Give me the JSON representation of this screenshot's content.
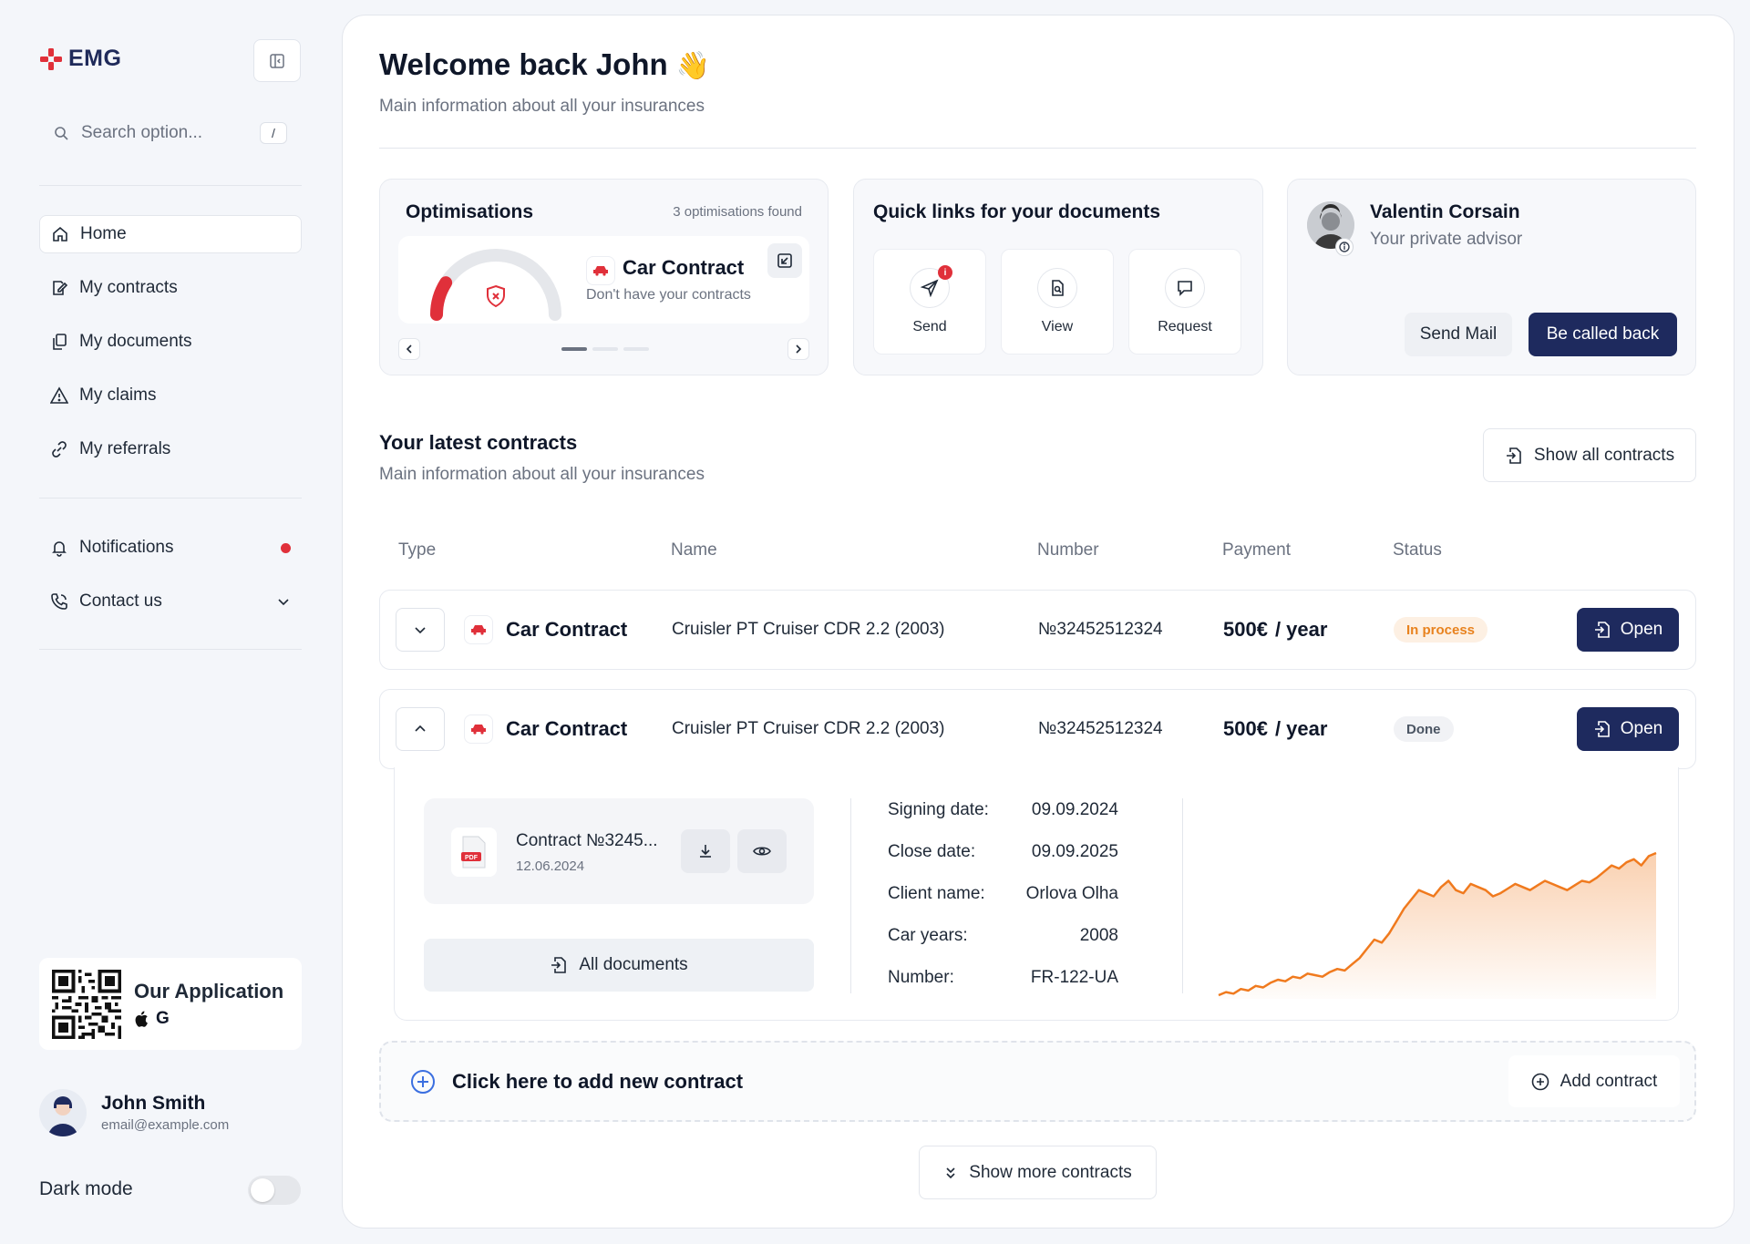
{
  "app": {
    "logo_text": "EMG",
    "brand_color": "#e0303a",
    "accent": "#1e2a5e"
  },
  "search": {
    "placeholder": "Search option...",
    "shortcut": "/"
  },
  "nav": {
    "items": [
      {
        "label": "Home",
        "icon": "home-icon"
      },
      {
        "label": "My contracts",
        "icon": "contract-icon"
      },
      {
        "label": "My documents",
        "icon": "documents-icon"
      },
      {
        "label": "My claims",
        "icon": "warning-icon"
      },
      {
        "label": "My referrals",
        "icon": "link-icon"
      }
    ],
    "notifications": "Notifications",
    "contact": "Contact us"
  },
  "app_promo": {
    "title": "Our Application",
    "stores": "G"
  },
  "user": {
    "name": "John Smith",
    "email": "email@example.com"
  },
  "dark_mode": {
    "label": "Dark mode"
  },
  "header": {
    "title": "Welcome back John",
    "emoji": "👋",
    "subtitle": "Main information about all your insurances"
  },
  "optimisations": {
    "title": "Optimisations",
    "count": "3 optimisations found",
    "gauge_fraction": 0.18,
    "item_title": "Car Contract",
    "item_sub": "Don't have your contracts"
  },
  "quick_links": {
    "title": "Quick links for your documents",
    "items": [
      {
        "label": "Send",
        "badge": "i"
      },
      {
        "label": "View"
      },
      {
        "label": "Request"
      }
    ]
  },
  "advisor": {
    "name": "Valentin Corsain",
    "role": "Your private advisor",
    "send_mail": "Send Mail",
    "call_back": "Be called back"
  },
  "contracts": {
    "title": "Your latest contracts",
    "subtitle": "Main information about all your insurances",
    "show_all": "Show all contracts",
    "columns": [
      "Type",
      "Name",
      "Number",
      "Payment",
      "Status"
    ],
    "rows": [
      {
        "type": "Car Contract",
        "name": "Cruisler PT Cruiser CDR 2.2 (2003)",
        "number": "№32452512324",
        "payment": "500€",
        "period": "/ year",
        "status": "In process",
        "action": "Open"
      },
      {
        "type": "Car Contract",
        "name": "Cruisler PT Cruiser CDR 2.2 (2003)",
        "number": "№32452512324",
        "payment": "500€",
        "period": "/ year",
        "status": "Done",
        "action": "Open"
      }
    ],
    "detail": {
      "file_name": "Contract №3245...",
      "file_date": "12.06.2024",
      "file_type": "PDF",
      "all_documents": "All documents",
      "fields": [
        {
          "label": "Signing date:",
          "value": "09.09.2024"
        },
        {
          "label": "Close date:",
          "value": "09.09.2025"
        },
        {
          "label": "Client name:",
          "value": "Orlova Olha"
        },
        {
          "label": "Car years:",
          "value": "2008"
        },
        {
          "label": "Number:",
          "value": "FR-122-UA"
        }
      ]
    },
    "add_prompt": "Click here to add new contract",
    "add_button": "Add contract",
    "show_more": "Show more contracts"
  },
  "chart_data": {
    "type": "area",
    "color": "#f07a1e",
    "values": [
      4,
      6,
      5,
      8,
      7,
      10,
      9,
      12,
      14,
      13,
      16,
      15,
      18,
      17,
      16,
      19,
      21,
      20,
      24,
      28,
      34,
      40,
      38,
      44,
      52,
      60,
      66,
      72,
      70,
      68,
      74,
      78,
      72,
      70,
      76,
      74,
      72,
      68,
      70,
      73,
      76,
      74,
      72,
      75,
      78,
      76,
      74,
      72,
      75,
      78,
      77,
      80,
      84,
      88,
      86,
      90,
      92,
      88,
      94,
      96
    ]
  }
}
